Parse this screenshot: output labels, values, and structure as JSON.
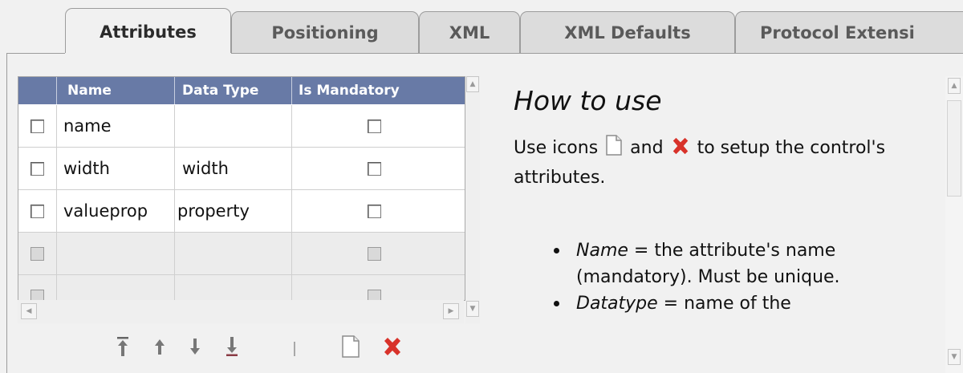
{
  "tabs": [
    {
      "label": "Attributes",
      "active": true
    },
    {
      "label": "Positioning",
      "active": false
    },
    {
      "label": "XML",
      "active": false
    },
    {
      "label": "XML Defaults",
      "active": false
    },
    {
      "label": "Protocol Extensi",
      "active": false
    }
  ],
  "grid": {
    "columns": [
      "Name",
      "Data Type",
      "Is Mandatory"
    ],
    "rows": [
      {
        "name": "name",
        "data_type": "",
        "mandatory": false
      },
      {
        "name": "width",
        "data_type": "width",
        "mandatory": false
      },
      {
        "name": "valueprop",
        "data_type": "property",
        "mandatory": false
      }
    ]
  },
  "toolbar": {
    "icons": [
      "move-top-icon",
      "move-up-icon",
      "move-down-icon",
      "move-bottom-icon",
      "new-icon",
      "delete-icon"
    ]
  },
  "help": {
    "title": "How to use",
    "intro_before": "Use icons",
    "intro_and": "and",
    "intro_after": "to setup the control's attributes.",
    "bullets": [
      {
        "term": "Name",
        "text": " = the attribute's name (mandatory). Must be unique."
      },
      {
        "term": "Datatype",
        "text": " = name of the"
      }
    ]
  },
  "colors": {
    "header_bg": "#687aa6",
    "delete_red": "#d8322a",
    "tab_bg": "#dcdcdc",
    "panel_bg": "#f1f1f1"
  }
}
